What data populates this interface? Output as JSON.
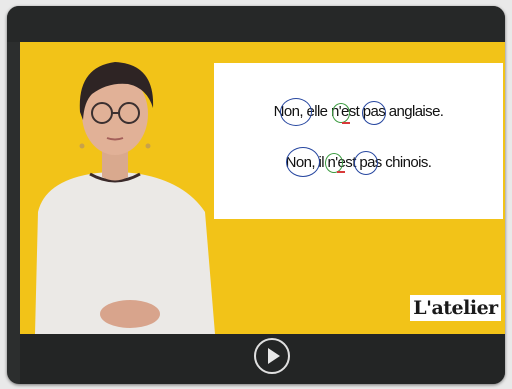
{
  "player": {
    "slide": {
      "sentence_1": "Non, elle n'est pas anglaise.",
      "sentence_2": "Non, il n'est pas chinois."
    },
    "logo": "L'atelier",
    "play_icon": "play-circle-icon"
  },
  "colors": {
    "background": "#f2c318",
    "circle_blue": "#2747a0",
    "circle_green": "#3a9a3f",
    "mark_red": "#d83a3a"
  }
}
